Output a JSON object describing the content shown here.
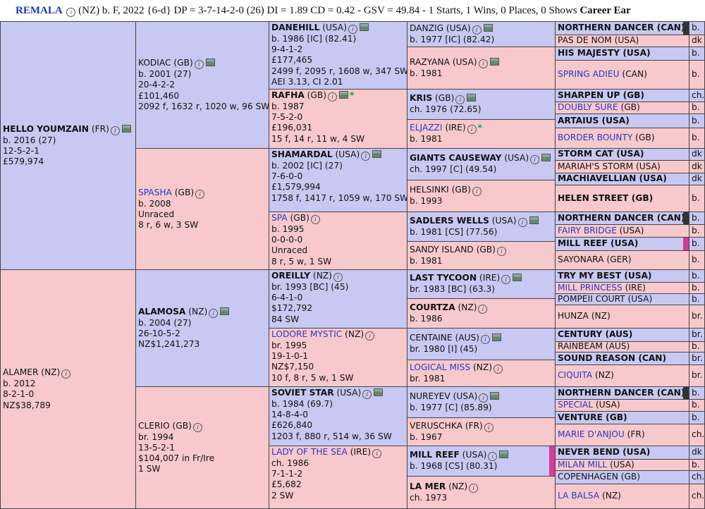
{
  "header": {
    "name": "REMALA",
    "rest": " (NZ) b. F, 2022 {6-d} DP = 3-7-14-2-0 (26) DI = 1.89   CD = 0.42 - GSV = 49.84 - 1 Starts, 1 Wins, 0 Places, 0 Shows",
    "tail": "Career Ear"
  },
  "g1": [
    {
      "name": "HELLO YOUMZAIN",
      "country": " (FR)",
      "lines": [
        "b. 2016 (27)",
        "12-5-2-1",
        "£579,974"
      ]
    },
    {
      "name": "ALAMER",
      "country": " (NZ)",
      "lines": [
        "b. 2012",
        "8-2-1-0",
        "NZ$38,789"
      ]
    }
  ],
  "g2": [
    {
      "name": "KODIAC",
      "country": " (GB)",
      "lines": [
        "b. 2001 (27)",
        "20-4-2-2",
        "£101,460",
        "2092 f, 1632 r, 1020 w, 96 SW"
      ]
    },
    {
      "name": "SPASHA",
      "country": " (GB)",
      "lines": [
        "b. 2008",
        "Unraced",
        "8 r, 6 w, 3 SW"
      ]
    },
    {
      "name": "ALAMOSA",
      "country": " (NZ)",
      "lines": [
        "b. 2004 (27)",
        "26-10-5-2",
        "NZ$1,241,273"
      ]
    },
    {
      "name": "CLERIO",
      "country": " (GB)",
      "lines": [
        "br. 1994",
        "13-5-2-1",
        "$104,007 in Fr/Ire",
        "1 SW"
      ]
    }
  ],
  "g3": [
    {
      "name": "DANEHILL",
      "country": " (USA)",
      "lines": [
        "b. 1986 [IC] (82.41)",
        "9-4-1-2",
        "£177,465",
        "2499 f, 2095 r, 1608 w, 347 SW",
        "AEI 3.13, CI 2.01"
      ]
    },
    {
      "name": "RAFHA",
      "country": " (GB)",
      "lines": [
        "b. 1987",
        "7-5-2-0",
        "£196,031",
        "15 f, 14 r, 11 w, 4 SW"
      ]
    },
    {
      "name": "SHAMARDAL",
      "country": " (USA)",
      "lines": [
        "b. 2002 [IC] (27)",
        "7-6-0-0",
        "£1,579,994",
        "1758 f, 1417 r, 1059 w, 170 SW"
      ]
    },
    {
      "name": "SPA",
      "country": " (GB)",
      "lines": [
        "b. 1995",
        "0-0-0-0",
        "Unraced",
        "8 r, 5 w, 1 SW"
      ]
    },
    {
      "name": "OREILLY",
      "country": " (NZ)",
      "lines": [
        "br. 1993 [BC] (45)",
        "6-4-1-0",
        "$172,792",
        "84 SW"
      ]
    },
    {
      "name": "LODORE MYSTIC",
      "country": " (NZ)",
      "lines": [
        "br. 1995",
        "19-1-0-1",
        "NZ$7,150",
        "10 f, 8 r, 5 w, 1 SW"
      ]
    },
    {
      "name": "SOVIET STAR",
      "country": " (USA)",
      "lines": [
        "b. 1984 (69.7)",
        "14-8-4-0",
        "£626,840",
        "1203 f, 880 r, 514 w, 36 SW"
      ]
    },
    {
      "name": "LADY OF THE SEA",
      "country": " (IRE)",
      "lines": [
        "ch. 1986",
        "7-1-1-2",
        "£5,682",
        "2 SW"
      ]
    }
  ],
  "g4": [
    {
      "name": "DANZIG",
      "country": " (USA)",
      "lines": [
        "b. 1977 [IC] (82.42)"
      ]
    },
    {
      "name": "RAZYANA",
      "country": " (USA)",
      "lines": [
        "b. 1981"
      ]
    },
    {
      "name": "KRIS",
      "country": " (GB)",
      "lines": [
        "ch. 1976 (72.65)"
      ]
    },
    {
      "name": "ELJAZZI",
      "country": " (IRE)",
      "lines": [
        "b. 1981"
      ]
    },
    {
      "name": "GIANTS CAUSEWAY",
      "country": " (USA)",
      "lines": [
        "ch. 1997 [C] (49.54)"
      ]
    },
    {
      "name": "HELSINKI",
      "country": " (GB)",
      "lines": [
        "b. 1993"
      ]
    },
    {
      "name": "SADLERS WELLS",
      "country": " (USA)",
      "lines": [
        "b. 1981 [CS] (77.56)"
      ]
    },
    {
      "name": "SANDY ISLAND",
      "country": " (GB)",
      "lines": [
        "b. 1981"
      ]
    },
    {
      "name": "LAST TYCOON",
      "country": " (IRE)",
      "lines": [
        "br. 1983 [BC] (63.3)"
      ]
    },
    {
      "name": "COURTZA",
      "country": " (NZ)",
      "lines": [
        "b. 1986"
      ]
    },
    {
      "name": "CENTAINE",
      "country": " (AUS)",
      "lines": [
        "br. 1980 [I] (45)"
      ]
    },
    {
      "name": "LOGICAL MISS",
      "country": " (NZ)",
      "lines": [
        "br. 1981"
      ]
    },
    {
      "name": "NUREYEV",
      "country": " (USA)",
      "lines": [
        "b. 1977 [C] (85.89)"
      ]
    },
    {
      "name": "VERUSCHKA",
      "country": " (FR)",
      "lines": [
        "b. 1967"
      ]
    },
    {
      "name": "MILL REEF",
      "country": " (USA)",
      "lines": [
        "b. 1968 [CS] (80.31)"
      ]
    },
    {
      "name": "LA MER",
      "country": " (NZ)",
      "lines": [
        "ch. 1973"
      ]
    }
  ],
  "g5": [
    {
      "name": "NORTHERN DANCER",
      "country": " (CAN)",
      "color": "b."
    },
    {
      "name": "PAS DE NOM",
      "country": " (USA)",
      "color": "dk"
    },
    {
      "name": "HIS MAJESTY",
      "country": " (USA)",
      "color": "b."
    },
    {
      "name": "SPRING ADIEU",
      "country": " (CAN)",
      "color": "b."
    },
    {
      "name": "SHARPEN UP",
      "country": " (GB)",
      "color": "ch."
    },
    {
      "name": "DOUBLY SURE",
      "country": " (GB)",
      "color": "b."
    },
    {
      "name": "ARTAIUS",
      "country": " (USA)",
      "color": "b."
    },
    {
      "name": "BORDER BOUNTY",
      "country": " (GB)",
      "color": "b."
    },
    {
      "name": "STORM CAT",
      "country": " (USA)",
      "color": "dk"
    },
    {
      "name": "MARIAH'S STORM",
      "country": " (USA)",
      "color": "dk"
    },
    {
      "name": "MACHIAVELLIAN",
      "country": " (USA)",
      "color": "dk"
    },
    {
      "name": "HELEN STREET",
      "country": " (GB)",
      "color": "b."
    },
    {
      "name": "NORTHERN DANCER",
      "country": " (CAN)",
      "color": "b."
    },
    {
      "name": "FAIRY BRIDGE",
      "country": " (USA)",
      "color": "b."
    },
    {
      "name": "MILL REEF",
      "country": " (USA)",
      "color": "b."
    },
    {
      "name": "SAYONARA",
      "country": " (GER)",
      "color": "b."
    },
    {
      "name": "TRY MY BEST",
      "country": " (USA)",
      "color": "b."
    },
    {
      "name": "MILL PRINCESS",
      "country": " (IRE)",
      "color": "b."
    },
    {
      "name": "POMPEII COURT",
      "country": " (USA)",
      "color": "b."
    },
    {
      "name": "HUNZA",
      "country": " (NZ)",
      "color": "br."
    },
    {
      "name": "CENTURY",
      "country": " (AUS)",
      "color": "br."
    },
    {
      "name": "RAINBEAM",
      "country": " (AUS)",
      "color": "b."
    },
    {
      "name": "SOUND REASON",
      "country": " (CAN)",
      "color": "br."
    },
    {
      "name": "CIQUITA",
      "country": " (NZ)",
      "color": "br."
    },
    {
      "name": "NORTHERN DANCER",
      "country": " (CAN)",
      "color": "b."
    },
    {
      "name": "SPECIAL",
      "country": " (USA)",
      "color": "b."
    },
    {
      "name": "VENTURE",
      "country": " (GB)",
      "color": "b."
    },
    {
      "name": "MARIE D'ANJOU",
      "country": " (FR)",
      "color": "ch."
    },
    {
      "name": "NEVER BEND",
      "country": " (USA)",
      "color": "dk"
    },
    {
      "name": "MILAN MILL",
      "country": " (USA)",
      "color": "b."
    },
    {
      "name": "COPENHAGEN",
      "country": " (GB)",
      "color": "ch."
    },
    {
      "name": "LA BALSA",
      "country": " (NZ)",
      "color": "ch."
    }
  ]
}
